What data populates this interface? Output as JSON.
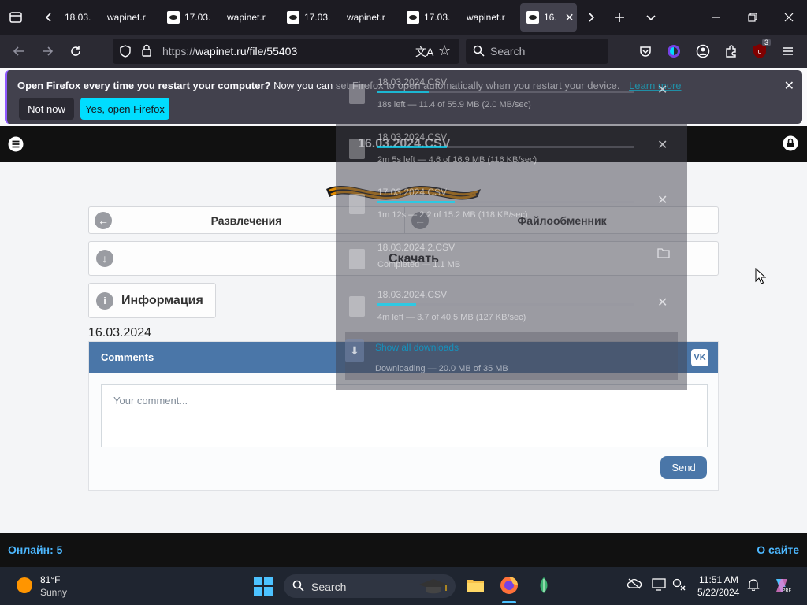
{
  "browser": {
    "tabs": [
      {
        "label": "18.03.",
        "active": false
      },
      {
        "label": "wapinet.r",
        "active": false
      },
      {
        "label": "17.03.",
        "active": false
      },
      {
        "label": "wapinet.r",
        "active": false
      },
      {
        "label": "17.03.",
        "active": false
      },
      {
        "label": "wapinet.r",
        "active": false
      },
      {
        "label": "17.03.",
        "active": false
      },
      {
        "label": "wapinet.r",
        "active": false
      },
      {
        "label": "16.",
        "active": true
      }
    ],
    "url_prefix": "https://",
    "url_host_path": "wapinet.ru/file/55403",
    "search_placeholder": "Search",
    "extension_badge": "3",
    "notification": {
      "bold": "Open Firefox every time you restart your computer?",
      "text": "Now you can set Firefox to open automatically when you restart your device.",
      "link": "Learn more",
      "not_now": "Not now",
      "yes": "Yes, open Firefox"
    }
  },
  "page": {
    "title": "16.03.2024.CSV",
    "nav_left": "Развлечения",
    "nav_right": "Файлообменник",
    "download_label": "Скачать",
    "info_label": "Информация",
    "date": "16.03.2024",
    "comments_title": "Comments",
    "vk_label": "VK",
    "comment_placeholder": "Your comment...",
    "send_label": "Send",
    "footer_online": "Онлайн: 5",
    "footer_about": "О сайте"
  },
  "downloads": {
    "items": [
      {
        "name": "18.03.2024.CSV",
        "status": "18s left — 11.4 of 55.9 MB (2.0 MB/sec)",
        "progress": 0.2
      },
      {
        "name": "18.03.2024.CSV",
        "status": "2m 5s left — 4.6 of 16.9 MB (116 KB/sec)",
        "progress": 0.27
      },
      {
        "name": "17.03.2024.CSV",
        "status": "1m 12s — 2.2 of 15.2 MB (118 KB/sec)",
        "progress": 0.3
      },
      {
        "name": "18.03.2024.2.CSV",
        "status": "Completed — 1.1 MB",
        "progress": 1.0
      },
      {
        "name": "18.03.2024.CSV",
        "status": "4m left — 3.7 of 40.5 MB (127 KB/sec)",
        "progress": 0.15
      }
    ],
    "footer_name": "Show all downloads",
    "footer_status": "Downloading — 20.0 MB of 35 MB"
  },
  "taskbar": {
    "weather_temp": "81°F",
    "weather_desc": "Sunny",
    "search_label": "Search",
    "time": "11:51 AM",
    "date": "5/22/2024"
  },
  "colors": {
    "accent_firefox": "#00ddff",
    "vk_blue": "#4a76a8",
    "footer_link": "#4db8ff"
  }
}
